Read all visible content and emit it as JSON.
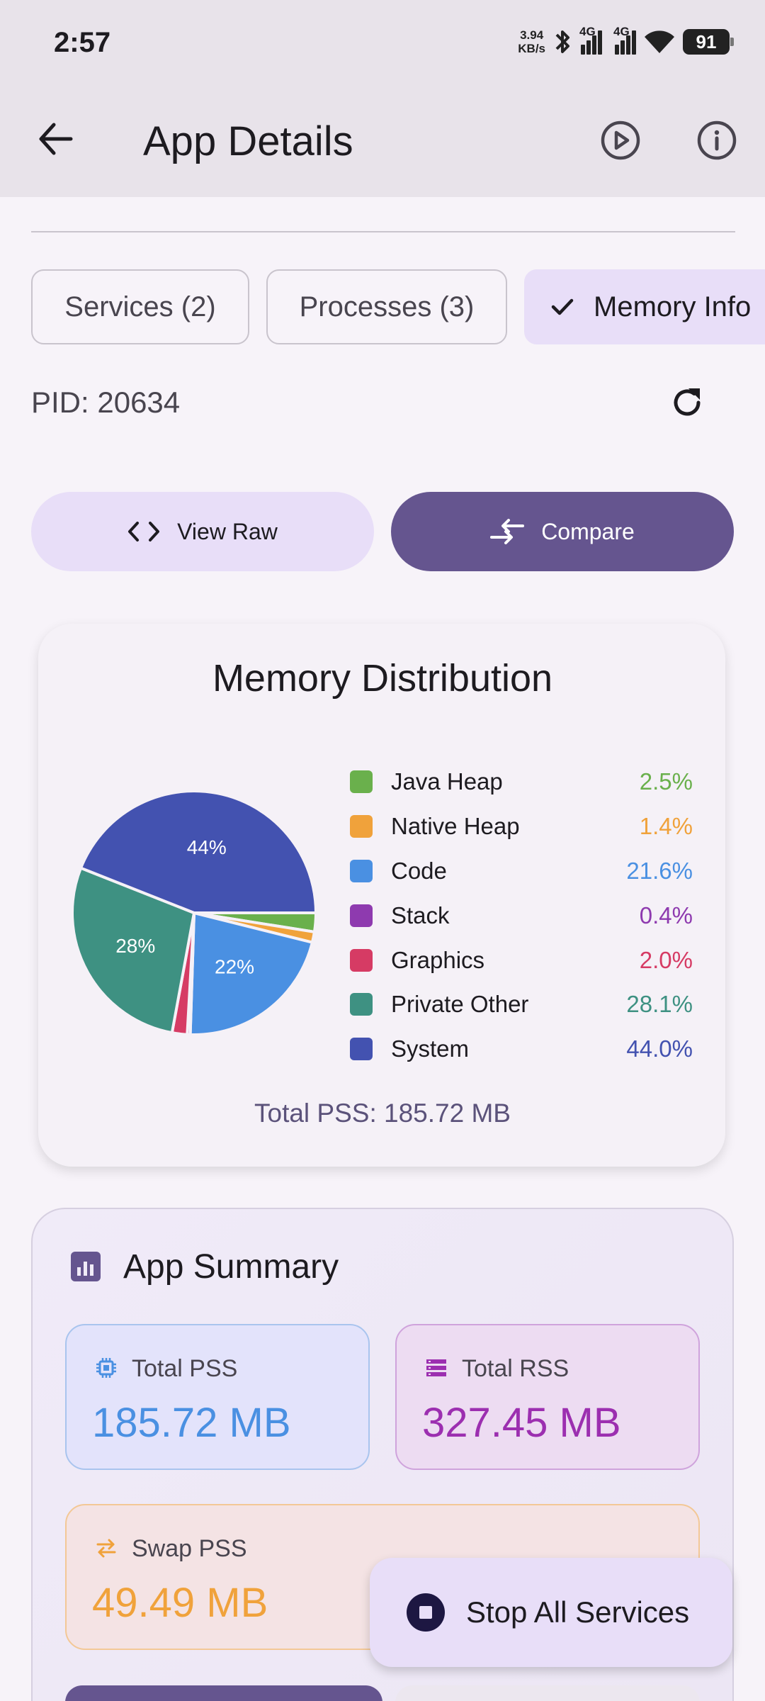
{
  "status_bar": {
    "time": "2:57",
    "net_speed_value": "3.94",
    "net_speed_unit": "KB/s",
    "network_1": "4G",
    "network_2": "4G",
    "battery": "91"
  },
  "app_bar": {
    "title": "App Details",
    "icons": [
      "back-arrow-icon",
      "play-circle-icon",
      "info-icon"
    ]
  },
  "tabs": [
    {
      "label": "Services (2)",
      "selected": false
    },
    {
      "label": "Processes (3)",
      "selected": false
    },
    {
      "label": "Memory Info",
      "selected": true
    }
  ],
  "pid_label": "PID: 20634",
  "buttons": {
    "view_raw": "View Raw",
    "compare": "Compare"
  },
  "chart_data": {
    "type": "pie",
    "title": "Memory Distribution",
    "categories": [
      "Java Heap",
      "Native Heap",
      "Code",
      "Stack",
      "Graphics",
      "Private Other",
      "System"
    ],
    "values": [
      2.5,
      1.4,
      21.6,
      0.4,
      2.0,
      28.1,
      44.0
    ],
    "value_labels": [
      "2.5%",
      "1.4%",
      "21.6%",
      "0.4%",
      "2.0%",
      "28.1%",
      "44.0%"
    ],
    "slice_labels": {
      "System": "44%",
      "Private Other": "28%",
      "Code": "22%"
    },
    "colors": [
      "#6ab04c",
      "#f0a23b",
      "#4a90e2",
      "#8e3aaf",
      "#d63b64",
      "#3e9182",
      "#4352b0"
    ],
    "legend": "right",
    "footer": "Total PSS: 185.72 MB"
  },
  "summary": {
    "title": "App Summary",
    "total_pss": {
      "label": "Total PSS",
      "value": "185.72 MB",
      "color": "#4a90e2"
    },
    "total_rss": {
      "label": "Total RSS",
      "value": "327.45 MB",
      "color": "#9c2fb0"
    },
    "swap_pss": {
      "label": "Swap PSS",
      "value": "49.49 MB",
      "color": "#f0a23b"
    }
  },
  "fab": {
    "label": "Stop All Services"
  }
}
